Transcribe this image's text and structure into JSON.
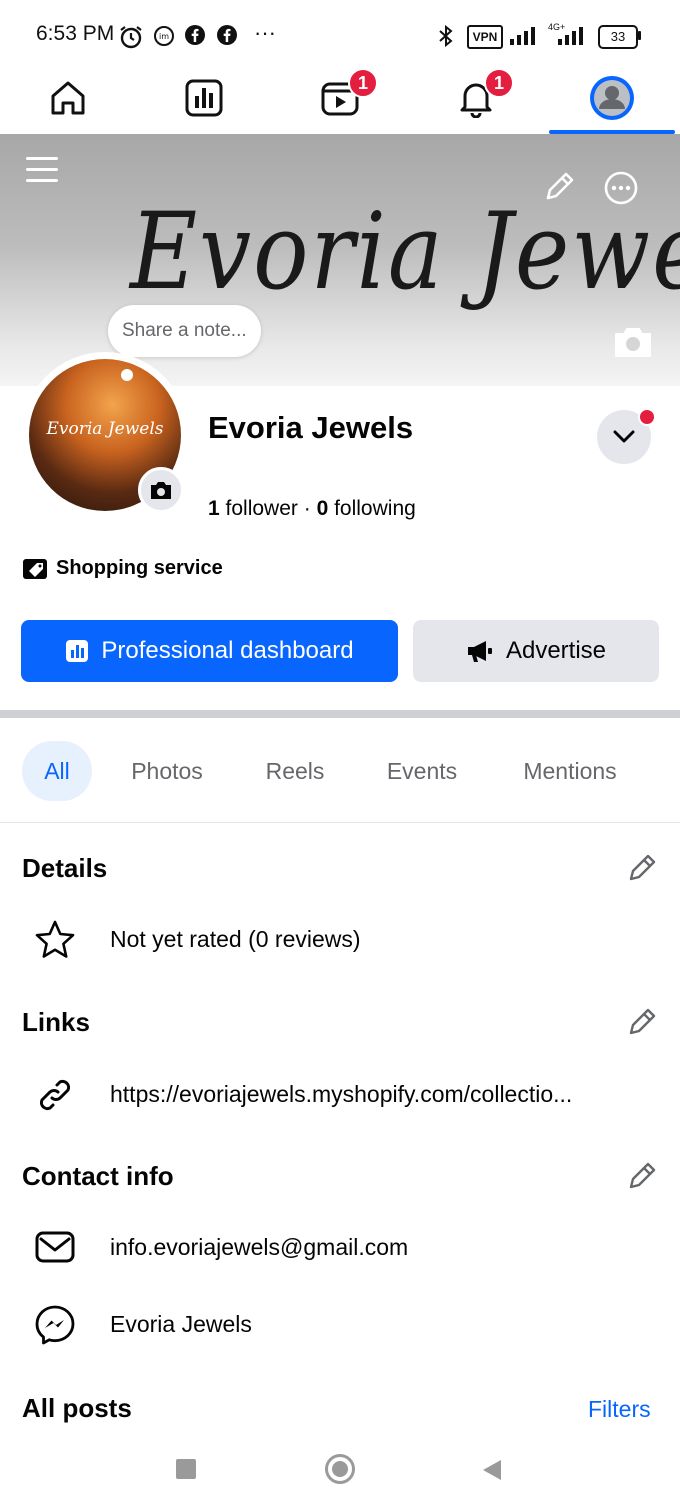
{
  "status_bar": {
    "time": "6:53 PM",
    "vpn": "VPN",
    "network": "4G+",
    "battery": "33",
    "more": "···"
  },
  "nav": {
    "tabs": [
      {
        "name": "home",
        "icon": "home-icon"
      },
      {
        "name": "dashboard",
        "icon": "bar-chart-icon"
      },
      {
        "name": "video",
        "icon": "video-icon",
        "badge": "1"
      },
      {
        "name": "notifications",
        "icon": "bell-icon",
        "badge": "1"
      },
      {
        "name": "profile",
        "icon": "profile-icon",
        "active": true
      }
    ]
  },
  "cover": {
    "script_text": "Evoria Jewels",
    "note_placeholder": "Share a note..."
  },
  "avatar": {
    "script_text": "Evoria Jewels"
  },
  "profile": {
    "name": "Evoria Jewels",
    "follower_count": "1",
    "follower_label": " follower",
    "separator": " · ",
    "following_count": "0",
    "following_label": " following",
    "category": "Shopping service"
  },
  "actions": {
    "primary_label": "Professional dashboard",
    "secondary_label": "Advertise"
  },
  "tabs": [
    "All",
    "Photos",
    "Reels",
    "Events",
    "Mentions"
  ],
  "details": {
    "title": "Details",
    "rating": "Not yet rated (0 reviews)"
  },
  "links": {
    "title": "Links",
    "url": "https://evoriajewels.myshopify.com/collectio..."
  },
  "contact": {
    "title": "Contact info",
    "email": "info.evoriajewels@gmail.com",
    "messenger": "Evoria Jewels"
  },
  "posts": {
    "title": "All posts",
    "filters_label": "Filters"
  },
  "colors": {
    "accent": "#0866ff",
    "badge": "#e41e3f",
    "secondary_bg": "#e4e6eb",
    "muted_text": "#65676b"
  }
}
